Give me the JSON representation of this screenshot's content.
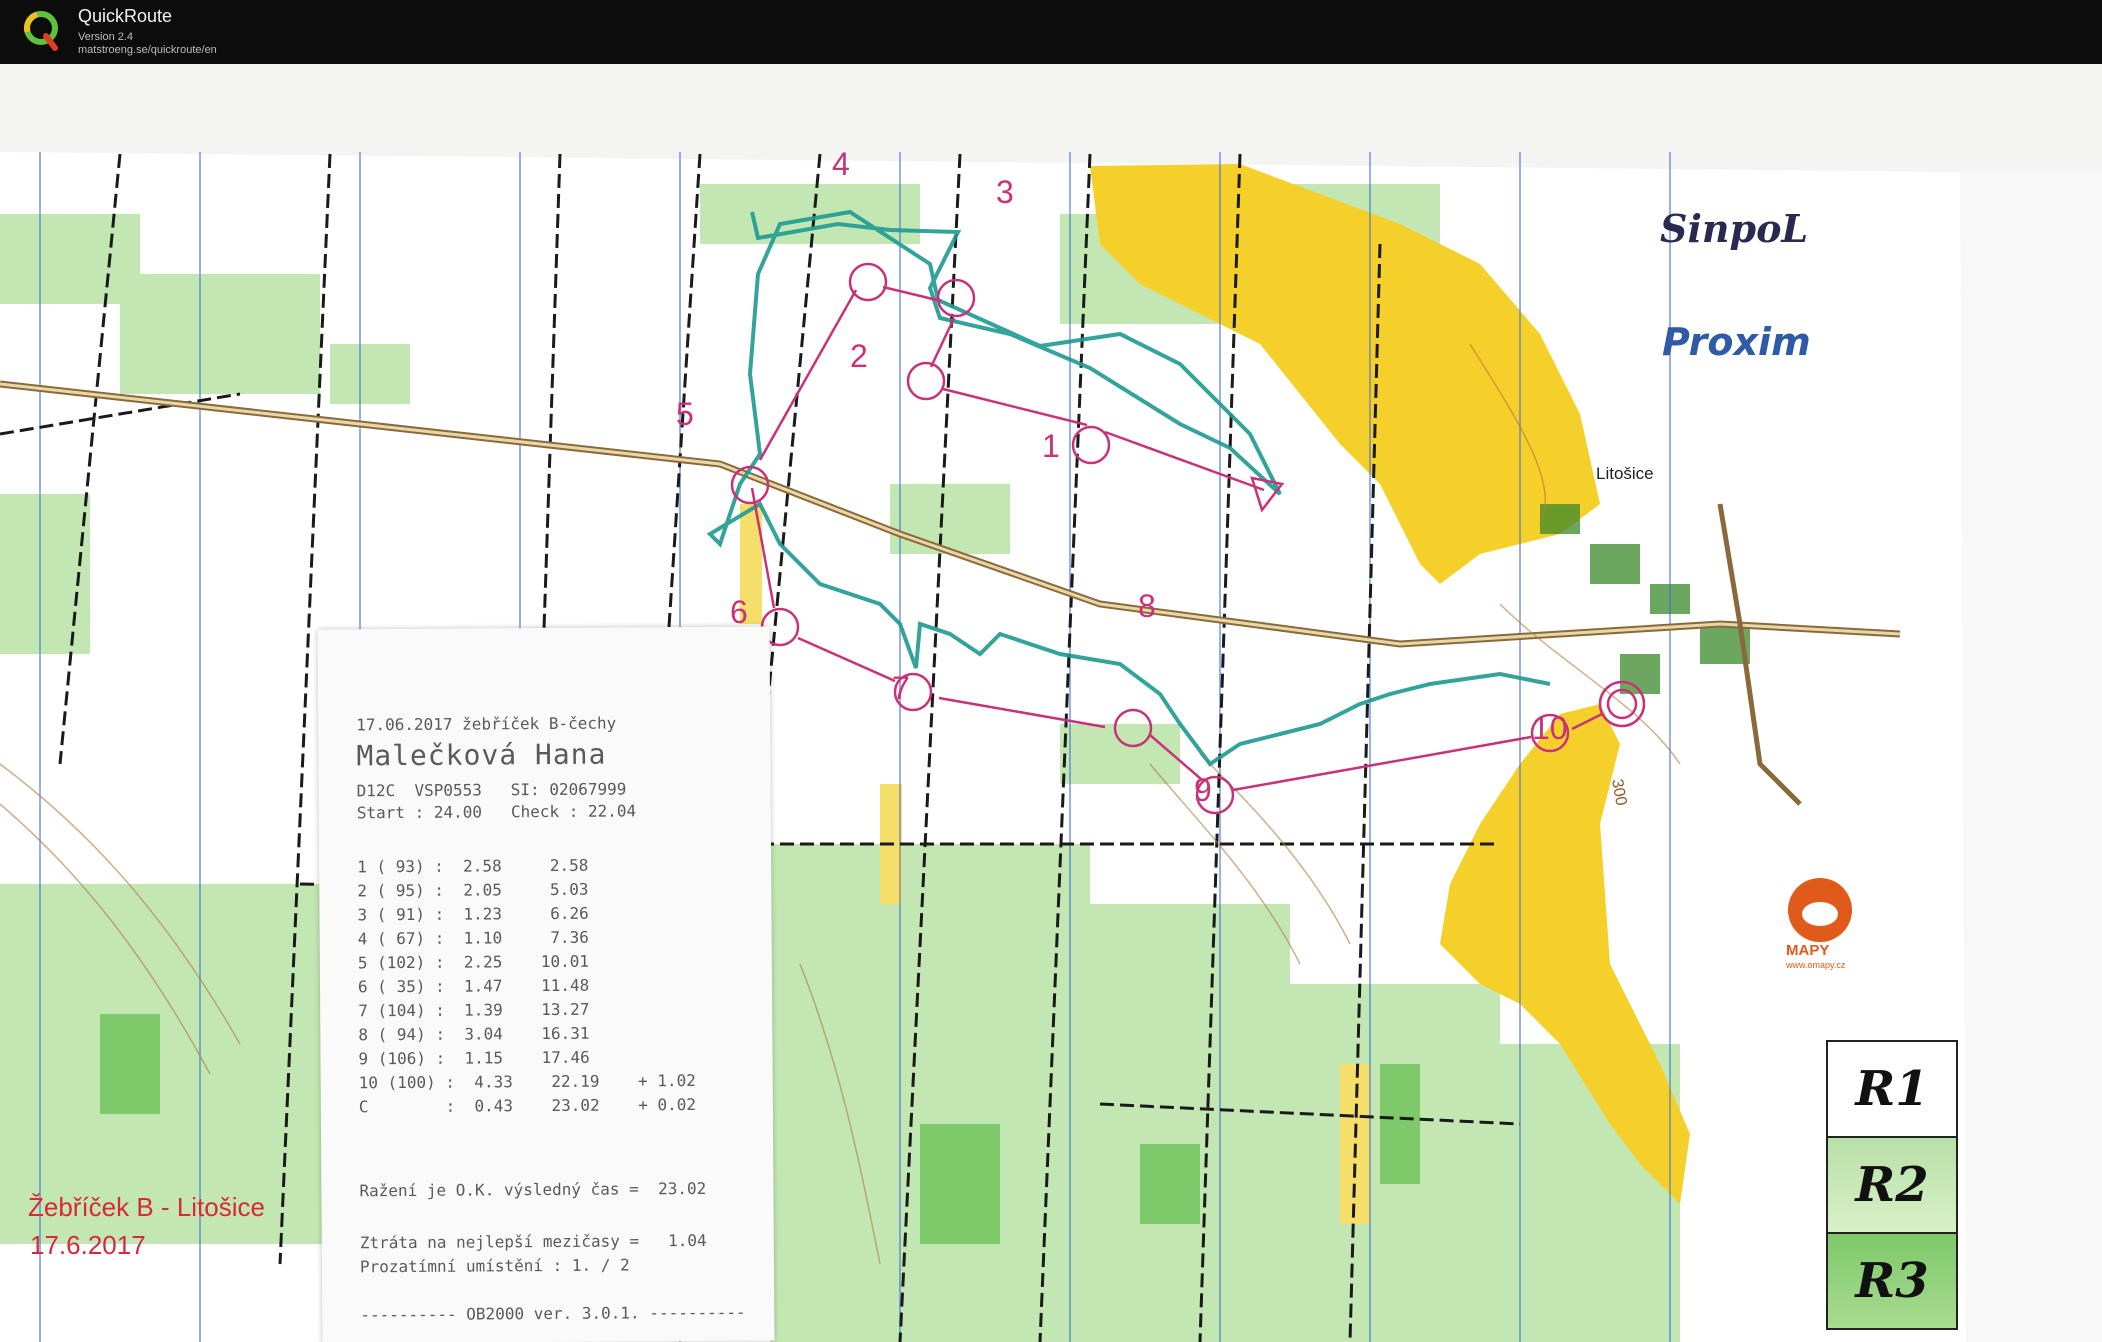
{
  "app": {
    "name": "QuickRoute",
    "version": "Version 2.4",
    "url": "matstroeng.se/quickroute/en"
  },
  "map": {
    "sponsor_1": "SinpoL",
    "sponsor_2": "Proxim",
    "village": "Litošice",
    "event_name": "Žebříček B - Litošice",
    "event_date": "17.6.2017",
    "contour_label": "300",
    "logo_word": "MAPY",
    "logo_url": "www.omapy.cz",
    "controls": [
      "1",
      "2",
      "3",
      "4",
      "5",
      "6",
      "7",
      "8",
      "9",
      "10"
    ],
    "route_boxes": [
      "R1",
      "R2",
      "R3"
    ],
    "colors": {
      "control_magenta": "#c8327a",
      "route_teal": "#1e9a90",
      "open_yellow": "#f5cf2a",
      "forest_green": "#8fd07a",
      "road_brown": "#8a6a3a"
    }
  },
  "receipt": {
    "header": "17.06.2017 žebříček B-čechy",
    "runner": "Malečková Hana",
    "class_line": "D12C  VSP0553   SI: 02067999",
    "start_line": "Start : 24.00   Check : 22.04",
    "splits": [
      "1 ( 93) :  2.58     2.58",
      "2 ( 95) :  2.05     5.03",
      "3 ( 91) :  1.23     6.26",
      "4 ( 67) :  1.10     7.36",
      "5 (102) :  2.25    10.01",
      "6 ( 35) :  1.47    11.48",
      "7 (104) :  1.39    13.27",
      "8 ( 94) :  3.04    16.31",
      "9 (106) :  1.15    17.46",
      "10 (100) :  4.33    22.19    + 1.02",
      "C        :  0.43    23.02    + 0.02"
    ],
    "result_line": "Ražení je O.K. výsledný čas =  23.02",
    "loss_line": "Ztráta na nejlepší mezičasy =   1.04",
    "place_line": "Prozatímní umístění : 1. / 2",
    "footer": "---------- OB2000 ver. 3.0.1. ----------"
  }
}
